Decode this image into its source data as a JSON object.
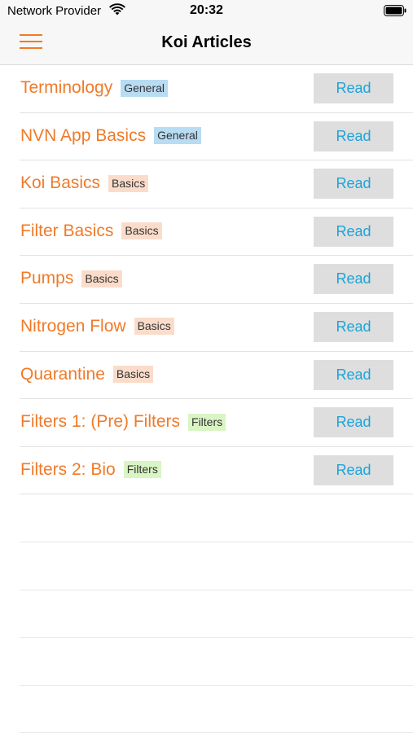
{
  "status_bar": {
    "carrier": "Network Provider",
    "time": "20:32",
    "wifi_icon": "wifi-icon",
    "battery_icon": "battery-icon"
  },
  "nav": {
    "title": "Koi Articles",
    "menu_icon": "hamburger-menu-icon"
  },
  "colors": {
    "accent": "#f07a28",
    "link": "#1ea3d9",
    "tag_general": "#b8dcf2",
    "tag_basics": "#fbdccb",
    "tag_filters": "#daf5c4"
  },
  "articles": [
    {
      "title": "Terminology",
      "tag": "General",
      "tag_type": "general",
      "button": "Read"
    },
    {
      "title": "NVN App Basics",
      "tag": "General",
      "tag_type": "general",
      "button": "Read"
    },
    {
      "title": "Koi Basics",
      "tag": "Basics",
      "tag_type": "basics",
      "button": "Read"
    },
    {
      "title": "Filter Basics",
      "tag": "Basics",
      "tag_type": "basics",
      "button": "Read"
    },
    {
      "title": "Pumps",
      "tag": "Basics",
      "tag_type": "basics",
      "button": "Read"
    },
    {
      "title": "Nitrogen Flow",
      "tag": "Basics",
      "tag_type": "basics",
      "button": "Read"
    },
    {
      "title": "Quarantine",
      "tag": "Basics",
      "tag_type": "basics",
      "button": "Read"
    },
    {
      "title": "Filters 1: (Pre) Filters",
      "tag": "Filters",
      "tag_type": "filters",
      "button": "Read"
    },
    {
      "title": "Filters 2: Bio",
      "tag": "Filters",
      "tag_type": "filters",
      "button": "Read"
    }
  ]
}
